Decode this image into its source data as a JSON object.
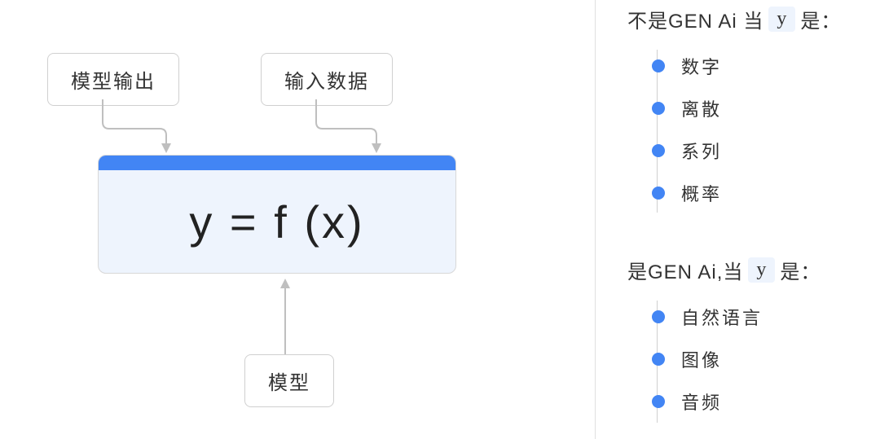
{
  "diagram": {
    "label_output": "模型输出",
    "label_input": "输入数据",
    "label_model": "模型",
    "formula": "y = f (x)"
  },
  "right": {
    "section1": {
      "prefix": "不是GEN Ai 当",
      "y": "y",
      "suffix": "是：",
      "items": [
        "数字",
        "离散",
        "系列",
        "概率"
      ]
    },
    "section2": {
      "prefix": "是GEN Ai,当",
      "y": "y",
      "suffix": "是：",
      "items": [
        "自然语言",
        "图像",
        "音频"
      ]
    }
  }
}
